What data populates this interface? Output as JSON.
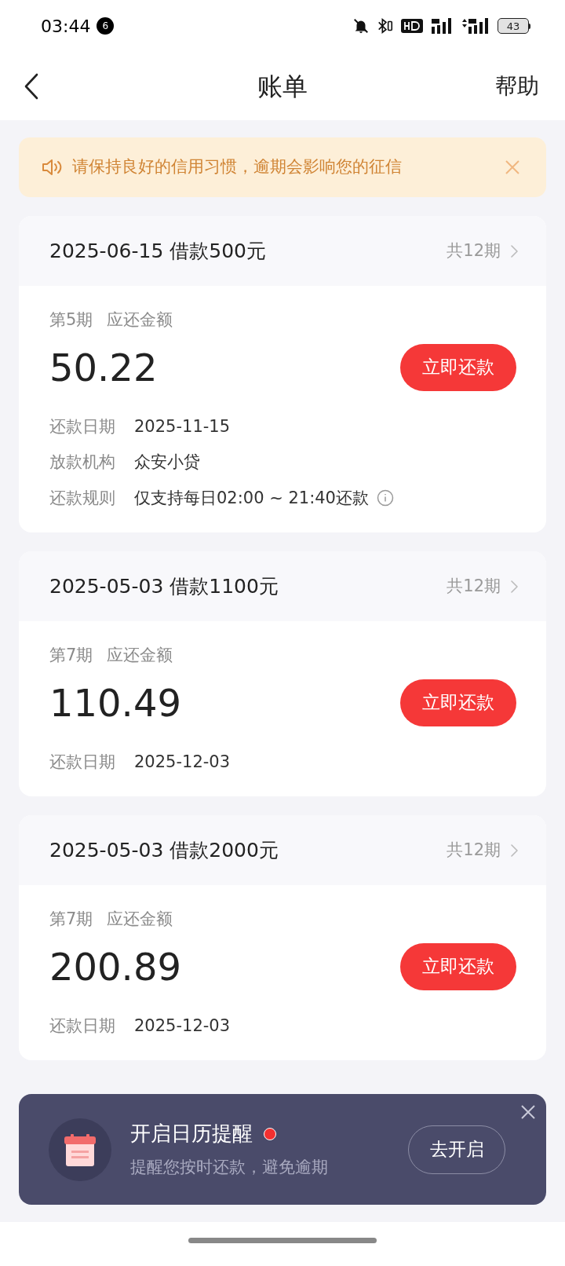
{
  "status_bar": {
    "time": "03:44",
    "notification_count": "6",
    "battery": "43"
  },
  "header": {
    "title": "账单",
    "help": "帮助"
  },
  "notice": {
    "text": "请保持良好的信用习惯，逾期会影响您的征信"
  },
  "bills": [
    {
      "title": "2025-06-15 借款500元",
      "total": "共12期",
      "period": "第5期",
      "amount_label": "应还金额",
      "amount": "50.22",
      "button": "立即还款",
      "details": [
        {
          "label": "还款日期",
          "value": "2025-11-15",
          "info": false
        },
        {
          "label": "放款机构",
          "value": "众安小贷",
          "info": false
        },
        {
          "label": "还款规则",
          "value": "仅支持每日02:00 ~ 21:40还款",
          "info": true
        }
      ]
    },
    {
      "title": "2025-05-03 借款1100元",
      "total": "共12期",
      "period": "第7期",
      "amount_label": "应还金额",
      "amount": "110.49",
      "button": "立即还款",
      "details": [
        {
          "label": "还款日期",
          "value": "2025-12-03",
          "info": false
        }
      ]
    },
    {
      "title": "2025-05-03 借款2000元",
      "total": "共12期",
      "period": "第7期",
      "amount_label": "应还金额",
      "amount": "200.89",
      "button": "立即还款",
      "details": [
        {
          "label": "还款日期",
          "value": "2025-12-03",
          "info": false
        }
      ]
    }
  ],
  "reminder": {
    "title": "开启日历提醒",
    "unread": true,
    "subtitle": "提醒您按时还款，避免逾期",
    "button": "去开启"
  }
}
